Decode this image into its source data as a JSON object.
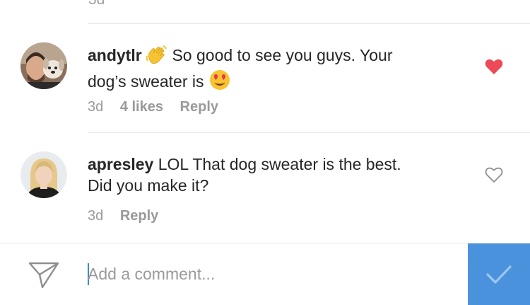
{
  "top_partial_text": "3d",
  "comments": [
    {
      "username": "andytlr",
      "text_before_line": "So good to see you guys. Your",
      "text_line2": "dog’s sweater is",
      "leading_emoji": "waving-hand",
      "trailing_emoji": "heart-eyes-face",
      "time": "3d",
      "likes": "4 likes",
      "reply_label": "Reply",
      "liked": true
    },
    {
      "username": "apresley",
      "text_before_line": "LOL That dog sweater is the best.",
      "text_line2": "Did you make it?",
      "time": "3d",
      "reply_label": "Reply",
      "liked": false
    }
  ],
  "composer": {
    "placeholder": "Add a comment...",
    "value": ""
  },
  "colors": {
    "liked_heart": "#ed4956",
    "accent": "#4a93dc",
    "meta_text": "#999999"
  },
  "icons": {
    "send": "paper-plane-icon",
    "post": "checkmark-icon",
    "like_filled": "heart-filled-icon",
    "like_outline": "heart-outline-icon"
  }
}
